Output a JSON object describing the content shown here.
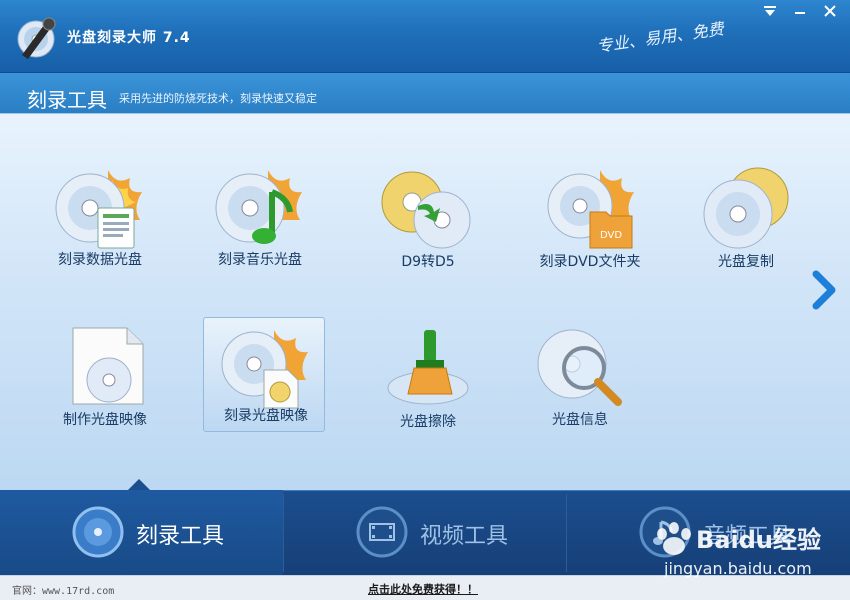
{
  "window": {
    "title": "光盘刻录大师 7.4",
    "tagline": "专业、易用、免费"
  },
  "section": {
    "title": "刻录工具",
    "subtitle": "采用先进的防烧死技术，刻录快速又稳定"
  },
  "tools": [
    {
      "label": "刻录数据光盘",
      "icon": "data-disc-burn-icon"
    },
    {
      "label": "刻录音乐光盘",
      "icon": "music-disc-burn-icon"
    },
    {
      "label": "D9转D5",
      "icon": "d9-to-d5-icon"
    },
    {
      "label": "刻录DVD文件夹",
      "icon": "dvd-folder-burn-icon"
    },
    {
      "label": "光盘复制",
      "icon": "disc-copy-icon"
    },
    {
      "label": "制作光盘映像",
      "icon": "make-disc-image-icon"
    },
    {
      "label": "刻录光盘映像",
      "icon": "burn-disc-image-icon"
    },
    {
      "label": "光盘擦除",
      "icon": "disc-erase-icon"
    },
    {
      "label": "光盘信息",
      "icon": "disc-info-icon"
    }
  ],
  "bottom_tabs": [
    {
      "label": "刻录工具",
      "icon": "burn-tools-icon"
    },
    {
      "label": "视频工具",
      "icon": "video-tools-icon"
    },
    {
      "label": "音频工具",
      "icon": "audio-tools-icon"
    }
  ],
  "footer": {
    "site": "官网：www.17rd.com",
    "promo": "点击此处免费获得！！"
  },
  "watermark": {
    "brand": "Baidu经验",
    "url": "jingyan.baidu.com"
  },
  "colors": {
    "titlebar": "#1f6fb9",
    "content_bg": "#d3e6f8",
    "bottom_bar": "#163f77",
    "label_text": "#1a3c66"
  }
}
